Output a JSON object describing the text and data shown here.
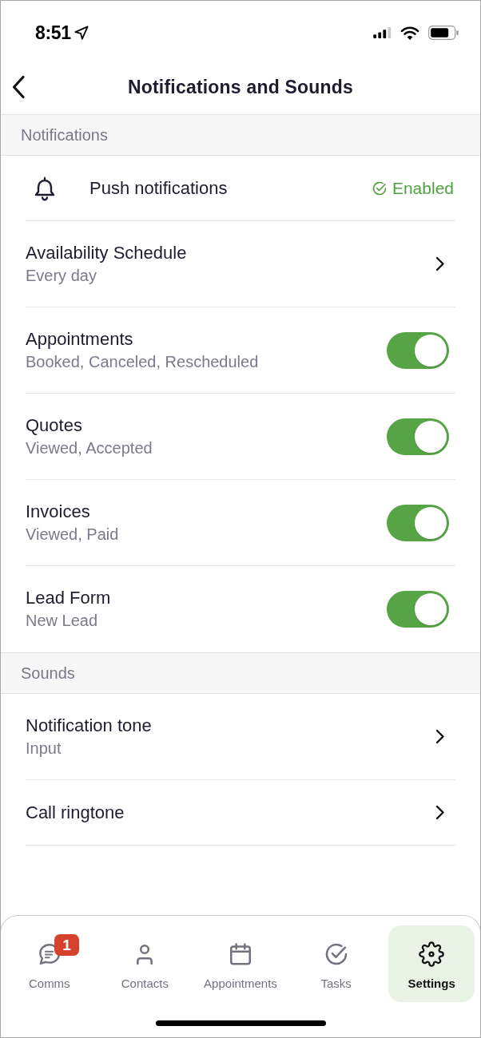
{
  "status_bar": {
    "time": "8:51"
  },
  "header": {
    "title": "Notifications and Sounds"
  },
  "sections": [
    {
      "title": "Notifications",
      "rows": [
        {
          "kind": "status",
          "label": "Push notifications",
          "status": "Enabled"
        },
        {
          "kind": "link",
          "label": "Availability Schedule",
          "subtitle": "Every day"
        },
        {
          "kind": "toggle",
          "label": "Appointments",
          "subtitle": "Booked, Canceled, Rescheduled",
          "on": true
        },
        {
          "kind": "toggle",
          "label": "Quotes",
          "subtitle": "Viewed, Accepted",
          "on": true
        },
        {
          "kind": "toggle",
          "label": "Invoices",
          "subtitle": "Viewed, Paid",
          "on": true
        },
        {
          "kind": "toggle",
          "label": "Lead Form",
          "subtitle": "New Lead",
          "on": true
        }
      ]
    },
    {
      "title": "Sounds",
      "rows": [
        {
          "kind": "link",
          "label": "Notification tone",
          "subtitle": "Input"
        },
        {
          "kind": "link",
          "label": "Call ringtone"
        }
      ]
    }
  ],
  "tab_bar": {
    "tabs": [
      {
        "label": "Comms",
        "badge": "1",
        "selected": false
      },
      {
        "label": "Contacts",
        "selected": false
      },
      {
        "label": "Appointments",
        "selected": false
      },
      {
        "label": "Tasks",
        "selected": false
      },
      {
        "label": "Settings",
        "selected": true
      }
    ]
  }
}
